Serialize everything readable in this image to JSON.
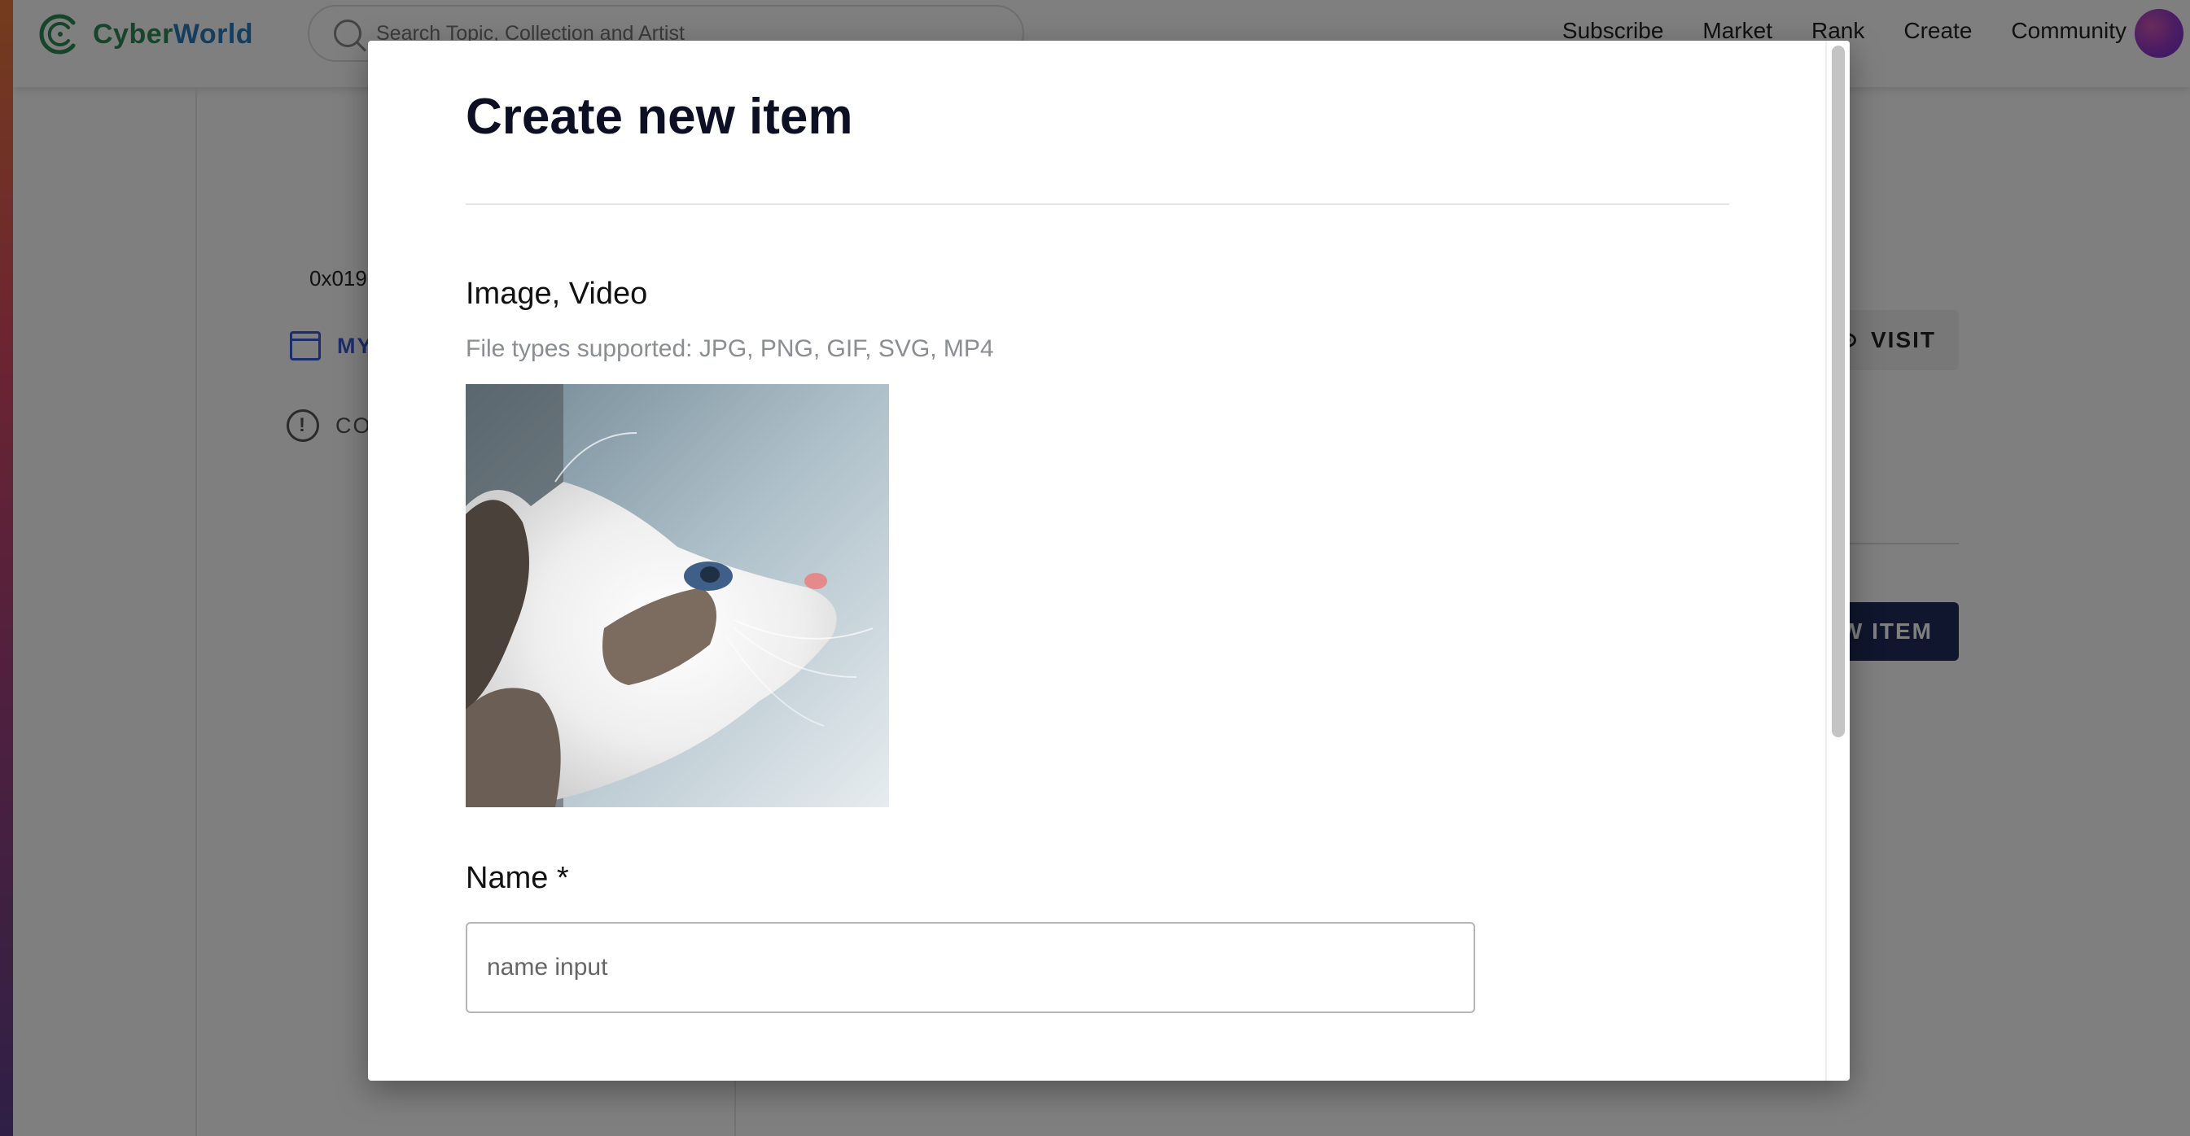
{
  "app": {
    "brand": "CyberWorld",
    "brand_part1": "Cyber",
    "brand_part2": "World",
    "search": {
      "placeholder": "Search Topic, Collection and Artist"
    },
    "nav": [
      {
        "label": "Subscribe"
      },
      {
        "label": "Market"
      },
      {
        "label": "Rank"
      },
      {
        "label": "Create"
      },
      {
        "label": "Community"
      }
    ]
  },
  "background": {
    "address_fragment": "0x019",
    "menu_my_fragment": "MY",
    "menu_co_fragment": "CO",
    "visit_label": "VISIT",
    "new_item_fragment": "EW ITEM"
  },
  "modal": {
    "title": "Create new item",
    "media_label": "Image, Video",
    "file_types_hint": "File types supported: JPG, PNG, GIF, SVG, MP4",
    "preview_image": "cat-photo",
    "name_label": "Name *",
    "name_placeholder": "name input"
  },
  "colors": {
    "accent_blue": "#3a5ad4",
    "button_dark": "#1f2d5a",
    "title_text": "#0d1024",
    "hint_text": "#8a8d92"
  },
  "icons": [
    "logo-icon",
    "search-icon",
    "avatar",
    "store-icon",
    "alert-icon",
    "eye-icon"
  ]
}
